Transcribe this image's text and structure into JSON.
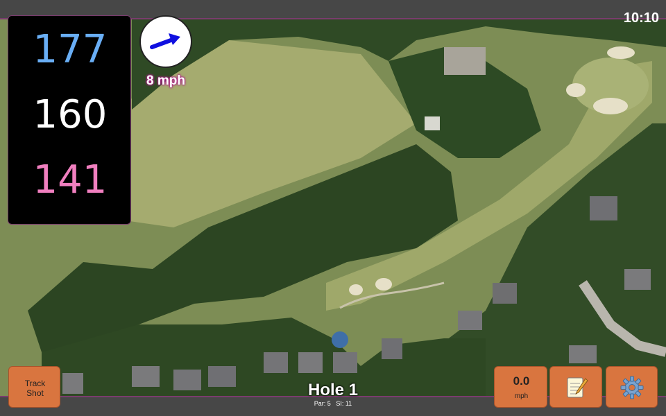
{
  "status_bar": {
    "time": "10:10"
  },
  "distances": {
    "back": "177",
    "middle": "160",
    "front": "141"
  },
  "wind": {
    "speed_label": "8 mph",
    "direction_icon": "wind-arrow-icon"
  },
  "buttons": {
    "track_shot_line1": "Track",
    "track_shot_line2": "Shot",
    "wind_value": "0.0",
    "wind_unit": "mph",
    "notes_icon": "notepad-icon",
    "settings_icon": "gear-icon"
  },
  "hole": {
    "title": "Hole 1",
    "par_label": "Par: 5",
    "si_label": "SI: 11"
  },
  "colors": {
    "back_distance": "#69aef5",
    "middle_distance": "#ffffff",
    "front_distance": "#f07fbf",
    "button_orange": "#d9753f",
    "accent_purple": "#7a3c6e"
  }
}
